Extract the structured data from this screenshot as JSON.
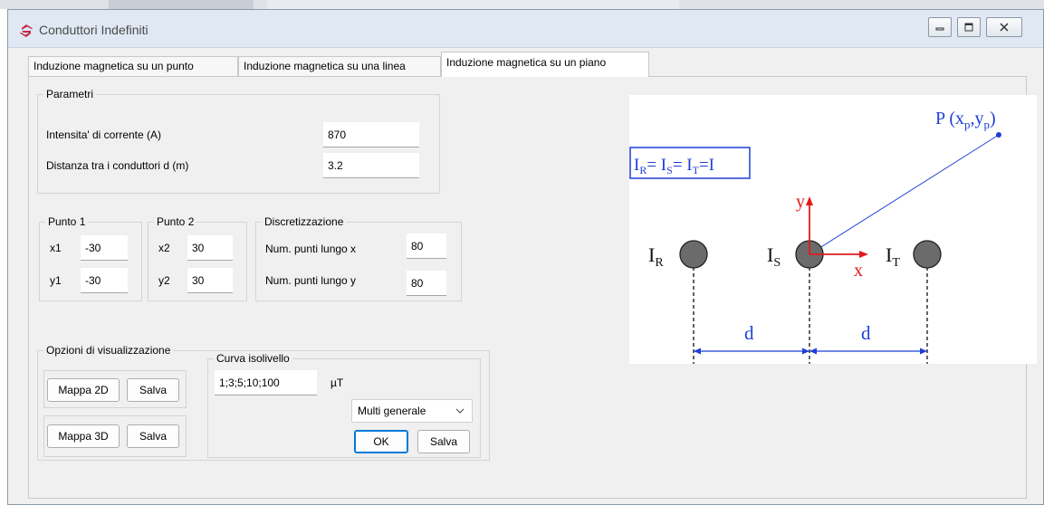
{
  "window": {
    "title": "Conduttori Indefiniti",
    "icon": "app-logo-icon",
    "controls": [
      "minimize-icon",
      "maximize-icon",
      "close-icon"
    ]
  },
  "tabs": [
    {
      "label": "Induzione magnetica su un punto",
      "active": false
    },
    {
      "label": "Induzione magnetica su una linea",
      "active": false
    },
    {
      "label": "Induzione magnetica su un piano",
      "active": true
    }
  ],
  "parametri": {
    "title": "Parametri",
    "corrente_label": "Intensita' di corrente (A)",
    "corrente_value": "870",
    "distanza_label": "Distanza tra i conduttori d (m)",
    "distanza_value": "3.2"
  },
  "punto1": {
    "title": "Punto 1",
    "x_label": "x1",
    "x_value": "-30",
    "y_label": "y1",
    "y_value": "-30"
  },
  "punto2": {
    "title": "Punto 2",
    "x_label": "x2",
    "x_value": "30",
    "y_label": "y2",
    "y_value": "30"
  },
  "discretizzazione": {
    "title": "Discretizzazione",
    "x_label": "Num. punti lungo x",
    "x_value": "80",
    "y_label": "Num. punti lungo y",
    "y_value": "80"
  },
  "opzioni": {
    "title": "Opzioni di visualizzazione",
    "mappa2d_label": "Mappa 2D",
    "mappa3d_label": "Mappa 3D",
    "salva_label": "Salva",
    "curva": {
      "title": "Curva isolivello",
      "value": "1;3;5;10;100",
      "unit": "µT",
      "select_value": "Multi generale",
      "ok_label": "OK",
      "salva_label": "Salva"
    }
  },
  "diagram": {
    "equation": "IR= IS= IT=I",
    "point": "P (xp,yp)",
    "conductors": [
      "IR",
      "IS",
      "IT"
    ],
    "axis_x": "x",
    "axis_y": "y",
    "distance": "d",
    "colors": {
      "blue": "#1f3fd6",
      "red": "#e11b1b",
      "conductor": "#6b6b6b"
    }
  }
}
